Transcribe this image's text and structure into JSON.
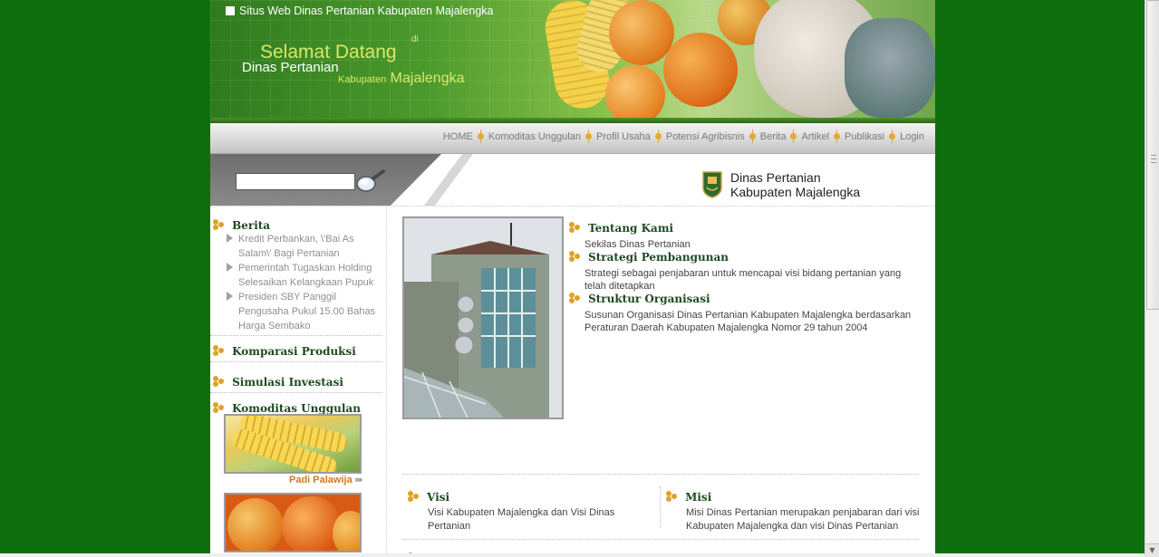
{
  "header": {
    "site_title": "Situs Web Dinas Pertanian Kabupaten Majalengka",
    "welcome_line1": "Selamat Datang",
    "welcome_di": "di",
    "welcome_line2": "Dinas Pertanian",
    "welcome_kabupaten": "Kabupaten",
    "welcome_majalengka": "Majalengka"
  },
  "nav": {
    "items": [
      {
        "label": "HOME"
      },
      {
        "label": "Komoditas Unggulan"
      },
      {
        "label": "Profil Usaha"
      },
      {
        "label": "Potensi Agribisnis"
      },
      {
        "label": "Berita"
      },
      {
        "label": "Artikel"
      },
      {
        "label": "Publikasi"
      },
      {
        "label": "Login"
      }
    ]
  },
  "search": {
    "value": "",
    "placeholder": ""
  },
  "logo": {
    "line1": "Dinas Pertanian",
    "line2": "Kabupaten Majalengka"
  },
  "sidebar": {
    "berita_title": "Berita",
    "news": [
      {
        "title": "Kredit Perbankan, \\'Bai As Salam\\' Bagi Pertanian"
      },
      {
        "title": "Pemerintah Tugaskan Holding Selesaikan Kelangkaan Pupuk"
      },
      {
        "title": "Presiden SBY Panggil Pengusaha Pukul 15.00 Bahas Harga Sembako"
      }
    ],
    "komparasi_title": "Komparasi Produksi",
    "simulasi_title": "Simulasi Investasi",
    "komoditas_title": "Komoditas Unggulan",
    "komoditas_caption": "Padi Palawija",
    "komoditas_arrow": "⇛"
  },
  "main": {
    "sections": [
      {
        "title": "Tentang Kami",
        "desc": "Sekilas Dinas Pertanian"
      },
      {
        "title": "Strategi Pembangunan",
        "desc": "Strategi sebagai penjabaran untuk mencapai visi bidang pertanian yang telah ditetapkan"
      },
      {
        "title": "Struktur Organisasi",
        "desc": "Susunan Organisasi Dinas Pertanian Kabupaten Majalengka berdasarkan Peraturan Daerah Kabupaten Majalengka Nomor 29 tahun 2004"
      }
    ],
    "visi": {
      "title": "Visi",
      "desc": "Visi Kabupaten Majalengka dan Visi Dinas Pertanian"
    },
    "misi": {
      "title": "Misi",
      "desc": "Misi Dinas Pertanian merupakan penjabaran dari visi Kabupaten Majalengka dan visi Dinas Pertanian"
    }
  },
  "colors": {
    "background": "#0e6e0e",
    "accent": "#e0a128",
    "heading": "#1f4a1f"
  }
}
